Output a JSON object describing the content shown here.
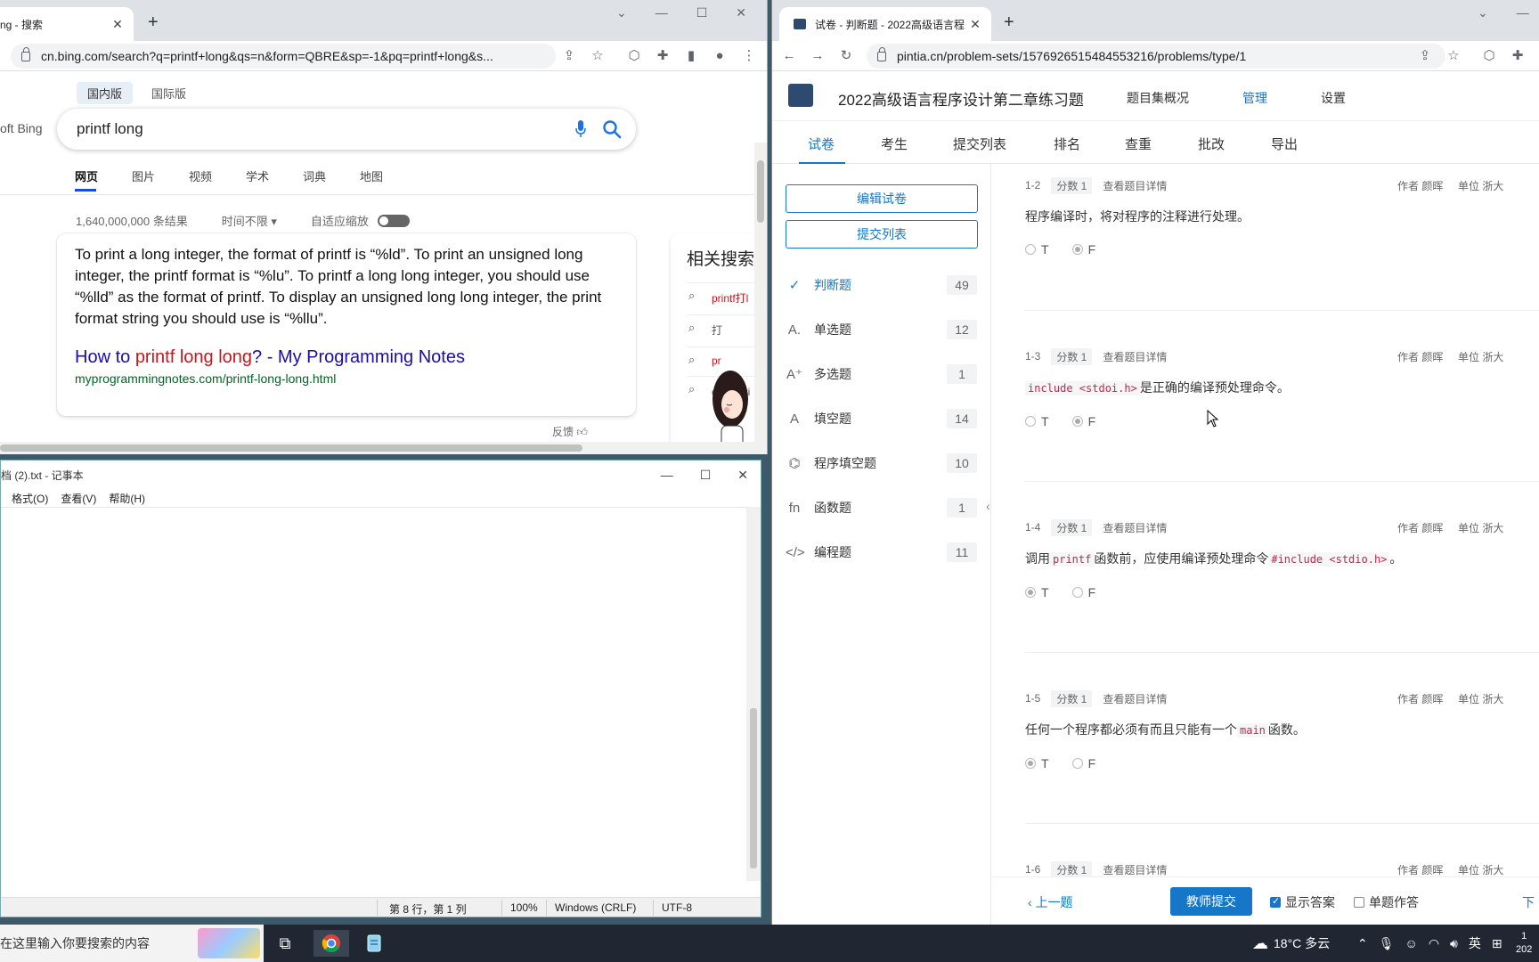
{
  "bing": {
    "tab_title": "ng - 搜索",
    "url": "cn.bing.com/search?q=printf+long&qs=n&form=QBRE&sp=-1&pq=printf+long&s...",
    "regions": [
      "国内版",
      "国际版"
    ],
    "logo_fragment": "oft Bing",
    "query": "printf long",
    "scopes": [
      "网页",
      "图片",
      "视频",
      "学术",
      "词典",
      "地图"
    ],
    "results_count": "1,640,000,000 条结果",
    "time_filter": "时间不限 ▾",
    "adaptive_zoom": "自适应缩放",
    "answer_text": "To print a long integer, the format of printf is “%ld”. To print an unsigned long integer, the printf format is “%lu”. To printf a long long integer, you should use “%lld” as the format of printf. To display an unsigned long long integer, the print format string you should use is “%llu”.",
    "link_pre": "How to ",
    "link_hl": "printf long long",
    "link_post": "? - My Programming Notes",
    "link_url": "myprogrammingnotes.com/printf-long-long.html",
    "feedback": "反馈",
    "related_title": "相关搜索",
    "related": [
      "printf打l",
      "打",
      "pr",
      "c语言pri"
    ]
  },
  "notepad": {
    "title": "档 (2).txt - 记事本",
    "menu": [
      "格式(O)",
      "查看(V)",
      "帮助(H)"
    ],
    "status_pos": "第 8 行，第 1 列",
    "status_zoom": "100%",
    "status_eol": "Windows (CRLF)",
    "status_enc": "UTF-8"
  },
  "pta": {
    "tab_title": "试卷 - 判断题 - 2022高级语言程",
    "url": "pintia.cn/problem-sets/1576926515484553216/problems/type/1",
    "title": "2022高级语言程序设计第二章练习题",
    "nav": [
      "题目集概况",
      "管理",
      "设置"
    ],
    "subtabs": [
      "试卷",
      "考生",
      "提交列表",
      "排名",
      "查重",
      "批改",
      "导出"
    ],
    "edit_btn": "编辑试卷",
    "submissions_btn": "提交列表",
    "types": [
      {
        "label": "判断题",
        "count": "49",
        "icon": "✓"
      },
      {
        "label": "单选题",
        "count": "12",
        "icon": "A."
      },
      {
        "label": "多选题",
        "count": "1",
        "icon": "A⁺"
      },
      {
        "label": "填空题",
        "count": "14",
        "icon": "A"
      },
      {
        "label": "程序填空题",
        "count": "10",
        "icon": "⌬"
      },
      {
        "label": "函数题",
        "count": "1",
        "icon": "fn"
      },
      {
        "label": "编程题",
        "count": "11",
        "icon": "</>"
      }
    ],
    "problems": [
      {
        "id": "1-2",
        "score": "分数 1",
        "detail": "查看题目详情",
        "author": "作者 颜晖",
        "unit": "单位 浙大",
        "q": "程序编译时，将对程序的注释进行处理。",
        "T": false,
        "F": true
      },
      {
        "id": "1-3",
        "score": "分数 1",
        "detail": "查看题目详情",
        "author": "作者 颜晖",
        "unit": "单位 浙大",
        "code1": "include <stdoi.h>",
        "q_after": "是正确的编译预处理命令。",
        "T": false,
        "F": true
      },
      {
        "id": "1-4",
        "score": "分数 1",
        "detail": "查看题目详情",
        "author": "作者 颜晖",
        "unit": "单位 浙大",
        "q_pre": "调用",
        "code1": "printf",
        "q_mid": "函数前，应使用编译预处理命令",
        "code2": "#include <stdio.h>",
        "q_end": "。",
        "T": true,
        "F": false
      },
      {
        "id": "1-5",
        "score": "分数 1",
        "detail": "查看题目详情",
        "author": "作者 颜晖",
        "unit": "单位 浙大",
        "q_pre": "任何一个程序都必须有而且只能有一个",
        "code1": "main",
        "q_end": "函数。",
        "T": true,
        "F": false
      },
      {
        "id": "1-6",
        "score": "分数 1",
        "detail": "查看题目详情",
        "author": "作者 颜晖",
        "unit": "单位 浙大"
      }
    ],
    "opt_T": "T",
    "opt_F": "F",
    "prev": "上一题",
    "teacher_submit": "教师提交",
    "show_answer": "显示答案",
    "single_answer": "单题作答",
    "next_fragment": "下"
  },
  "taskbar": {
    "search_placeholder": "在这里输入你要搜索的内容",
    "weather": "18°C 多云",
    "ime": "英",
    "time_fragment": "1",
    "date_fragment": "202"
  }
}
